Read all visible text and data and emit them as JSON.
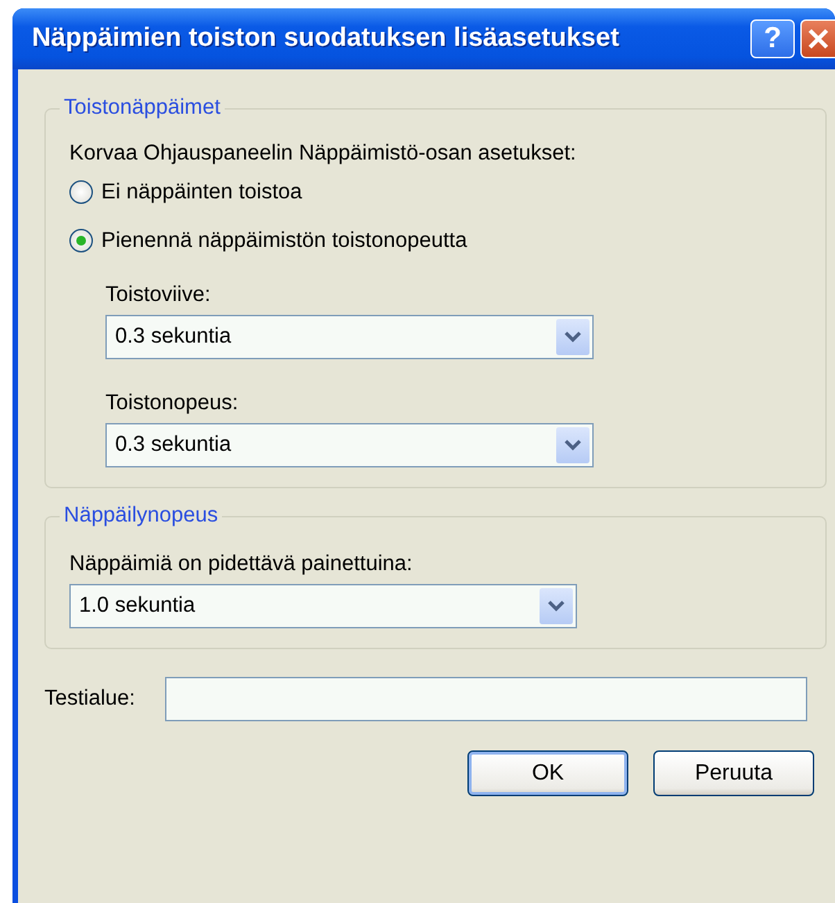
{
  "window": {
    "title": "Näppäimien toiston suodatuksen lisäasetukset",
    "help_button": "?"
  },
  "groups": [
    {
      "legend": "Toistonäppäimet",
      "intro": "Korvaa Ohjauspaneelin Näppäimistö-osan asetukset:",
      "radios": [
        {
          "label": "Ei näppäinten toistoa",
          "selected": false
        },
        {
          "label": "Pienennä näppäimistön toistonopeutta",
          "selected": true
        }
      ],
      "dropdowns": [
        {
          "label": "Toistoviive:",
          "value": "0.3 sekuntia"
        },
        {
          "label": "Toistonopeus:",
          "value": "0.3 sekuntia"
        }
      ]
    },
    {
      "legend": "Näppäilynopeus",
      "dropdowns": [
        {
          "label": "Näppäimiä on pidettävä painettuina:",
          "value": "1.0 sekuntia"
        }
      ]
    }
  ],
  "test_area": {
    "label": "Testialue:"
  },
  "buttons": [
    {
      "label": "OK",
      "default": true
    },
    {
      "label": "Peruuta",
      "default": false
    }
  ]
}
